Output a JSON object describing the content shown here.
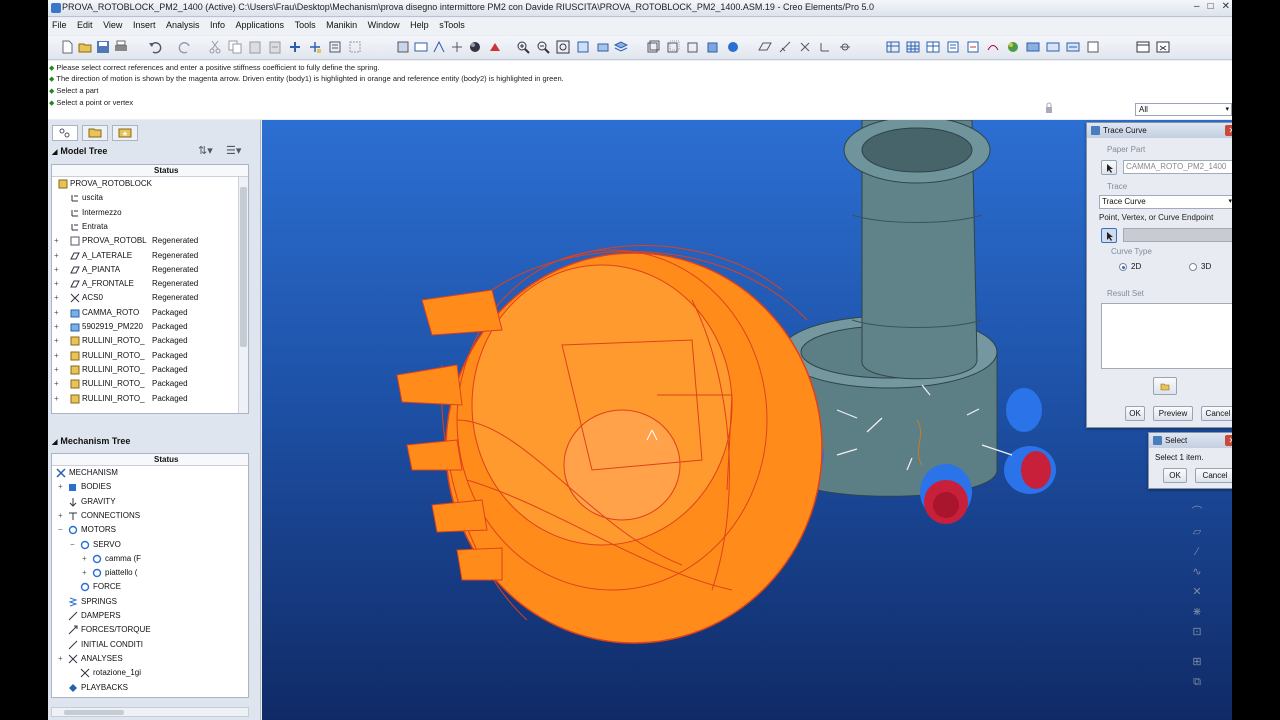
{
  "window": {
    "title": "PROVA_ROTOBLOCK_PM2_1400 (Active) C:\\Users\\Frau\\Desktop\\Mechanism\\prova disegno intermittore PM2 con Davide RIUSCITA\\PROVA_ROTOBLOCK_PM2_1400.ASM.19 - Creo Elements/Pro 5.0",
    "minimize": "–",
    "maximize": "□",
    "close": "✕"
  },
  "menu": [
    "File",
    "Edit",
    "View",
    "Insert",
    "Analysis",
    "Info",
    "Applications",
    "Tools",
    "Manikin",
    "Window",
    "Help",
    "sTools"
  ],
  "messages": [
    "Please select correct references and enter a positive stiffness coefficient to fully define the spring.",
    "The direction of motion is shown by the magenta arrow. Driven entity (body1) is highlighted in orange and reference entity (body2) is highlighted in green.",
    "Select a part",
    "Select a point or vertex"
  ],
  "filter": {
    "value": "All"
  },
  "model_tree": {
    "title": "Model Tree",
    "status_header": "Status",
    "rows": [
      {
        "name": "PROVA_ROTOBLOCK",
        "status": "",
        "icon": "assembly-icon"
      },
      {
        "name": "uscita",
        "status": "",
        "icon": "csys-icon"
      },
      {
        "name": "Intermezzo",
        "status": "",
        "icon": "csys-icon"
      },
      {
        "name": "Entrata",
        "status": "",
        "icon": "csys-icon"
      },
      {
        "name": "PROVA_ROTOBL",
        "status": "Regenerated",
        "icon": "layer-icon"
      },
      {
        "name": "A_LATERALE",
        "status": "Regenerated",
        "icon": "datum-plane-icon"
      },
      {
        "name": "A_PIANTA",
        "status": "Regenerated",
        "icon": "datum-plane-icon"
      },
      {
        "name": "A_FRONTALE",
        "status": "Regenerated",
        "icon": "datum-plane-icon"
      },
      {
        "name": "ACS0",
        "status": "Regenerated",
        "icon": "coordinate-system-icon"
      },
      {
        "name": "CAMMA_ROTO",
        "status": "Packaged",
        "icon": "part-icon"
      },
      {
        "name": "5902919_PM220",
        "status": "Packaged",
        "icon": "part-icon"
      },
      {
        "name": "RULLINI_ROTO_",
        "status": "Packaged",
        "icon": "subassembly-icon"
      },
      {
        "name": "RULLINI_ROTO_",
        "status": "Packaged",
        "icon": "subassembly-icon"
      },
      {
        "name": "RULLINI_ROTO_",
        "status": "Packaged",
        "icon": "subassembly-icon"
      },
      {
        "name": "RULLINI_ROTO_",
        "status": "Packaged",
        "icon": "subassembly-icon"
      },
      {
        "name": "RULLINI_ROTO_",
        "status": "Packaged",
        "icon": "subassembly-icon"
      }
    ]
  },
  "mechanism_tree": {
    "title": "Mechanism Tree",
    "status_header": "Status",
    "rows": [
      {
        "name": "MECHANISM",
        "icon": "mechanism-icon"
      },
      {
        "name": "BODIES",
        "icon": "bodies-icon"
      },
      {
        "name": "GRAVITY",
        "icon": "gravity-icon"
      },
      {
        "name": "CONNECTIONS",
        "icon": "connections-icon"
      },
      {
        "name": "MOTORS",
        "icon": "motor-icon"
      },
      {
        "name": "SERVO",
        "icon": "motor-icon"
      },
      {
        "name": "camma (F",
        "icon": "motor-icon"
      },
      {
        "name": "piattello (",
        "icon": "motor-icon"
      },
      {
        "name": "FORCE",
        "icon": "motor-icon"
      },
      {
        "name": "SPRINGS",
        "icon": "spring-icon"
      },
      {
        "name": "DAMPERS",
        "icon": "damper-icon"
      },
      {
        "name": "FORCES/TORQUE",
        "icon": "force-icon"
      },
      {
        "name": "INITIAL CONDITI",
        "icon": "initial-conditions-icon"
      },
      {
        "name": "ANALYSES",
        "icon": "analysis-icon"
      },
      {
        "name": "rotazione_1gi",
        "icon": "analysis-icon"
      },
      {
        "name": "PLAYBACKS",
        "icon": "playback-icon"
      }
    ]
  },
  "trace_curve": {
    "title": "Trace Curve",
    "paper_part_label": "Paper Part",
    "paper_part_value": "CAMMA_ROTO_PM2_1400",
    "trace_label": "Trace",
    "trace_value": "Trace Curve",
    "endpoint_label": "Point, Vertex, or Curve Endpoint",
    "curve_type_label": "Curve Type",
    "opt_2d": "2D",
    "opt_3d": "3D",
    "result_set_label": "Result Set",
    "ok": "OK",
    "preview": "Preview",
    "cancel": "Cancel"
  },
  "select_dialog": {
    "title": "Select",
    "message": "Select 1 item.",
    "ok": "OK",
    "cancel": "Cancel"
  },
  "colors": {
    "driven_body": "#ff8c1a",
    "reference_body": "#5c7f86",
    "roller_blue": "#2b73e8",
    "roller_red": "#c8203a",
    "viewport_top": "#2c6fd2",
    "viewport_bottom": "#102a66"
  }
}
